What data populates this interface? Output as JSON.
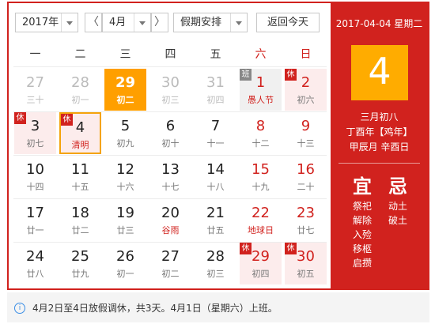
{
  "toolbar": {
    "year": "2017年",
    "prev": "〈",
    "month": "4月",
    "next": "〉",
    "holiday": "假期安排",
    "today_btn": "返回今天"
  },
  "weekdays": [
    "一",
    "二",
    "三",
    "四",
    "五",
    "六",
    "日"
  ],
  "days": [
    {
      "d": "27",
      "l": "三十",
      "other": true
    },
    {
      "d": "28",
      "l": "初一",
      "other": true
    },
    {
      "d": "29",
      "l": "初二",
      "selected": true
    },
    {
      "d": "30",
      "l": "初三",
      "other": true
    },
    {
      "d": "31",
      "l": "初四",
      "other": true
    },
    {
      "d": "1",
      "l": "愚人节",
      "red": true,
      "redlunar": true,
      "tag": "班"
    },
    {
      "d": "2",
      "l": "初六",
      "red": true,
      "tag": "休"
    },
    {
      "d": "3",
      "l": "初七",
      "tag": "休"
    },
    {
      "d": "4",
      "l": "清明",
      "redlunar": true,
      "tag": "休",
      "today": true
    },
    {
      "d": "5",
      "l": "初九"
    },
    {
      "d": "6",
      "l": "初十"
    },
    {
      "d": "7",
      "l": "十一"
    },
    {
      "d": "8",
      "l": "十二",
      "red": true
    },
    {
      "d": "9",
      "l": "十三",
      "red": true
    },
    {
      "d": "10",
      "l": "十四"
    },
    {
      "d": "11",
      "l": "十五"
    },
    {
      "d": "12",
      "l": "十六"
    },
    {
      "d": "13",
      "l": "十七"
    },
    {
      "d": "14",
      "l": "十八"
    },
    {
      "d": "15",
      "l": "十九",
      "red": true
    },
    {
      "d": "16",
      "l": "二十",
      "red": true
    },
    {
      "d": "17",
      "l": "廿一"
    },
    {
      "d": "18",
      "l": "廿二"
    },
    {
      "d": "19",
      "l": "廿三"
    },
    {
      "d": "20",
      "l": "谷雨",
      "redlunar": true
    },
    {
      "d": "21",
      "l": "廿五"
    },
    {
      "d": "22",
      "l": "地球日",
      "red": true,
      "redlunar": true
    },
    {
      "d": "23",
      "l": "廿七",
      "red": true
    },
    {
      "d": "24",
      "l": "廿八"
    },
    {
      "d": "25",
      "l": "廿九"
    },
    {
      "d": "26",
      "l": "初一"
    },
    {
      "d": "27",
      "l": "初二"
    },
    {
      "d": "28",
      "l": "初三"
    },
    {
      "d": "29",
      "l": "初四",
      "red": true,
      "tag": "休"
    },
    {
      "d": "30",
      "l": "初五",
      "red": true,
      "tag": "休"
    }
  ],
  "side": {
    "date": "2017-04-04 星期二",
    "day": "4",
    "lunar1": "三月初八",
    "lunar2": "丁酉年【鸡年】",
    "lunar3": "甲辰月 辛酉日",
    "yi_label": "宜",
    "ji_label": "忌",
    "yi": [
      "祭祀",
      "解除",
      "入殓",
      "移柩",
      "启攒"
    ],
    "ji": [
      "动土",
      "破土"
    ]
  },
  "info": {
    "icon": "info-icon",
    "text": "4月2日至4日放假调休，共3天。4月1日（星期六）上班。"
  },
  "colors": {
    "accent": "#d1221e",
    "selected": "#ff9f00",
    "today_border": "#f4a30b",
    "big_day_box": "#ffac00"
  }
}
